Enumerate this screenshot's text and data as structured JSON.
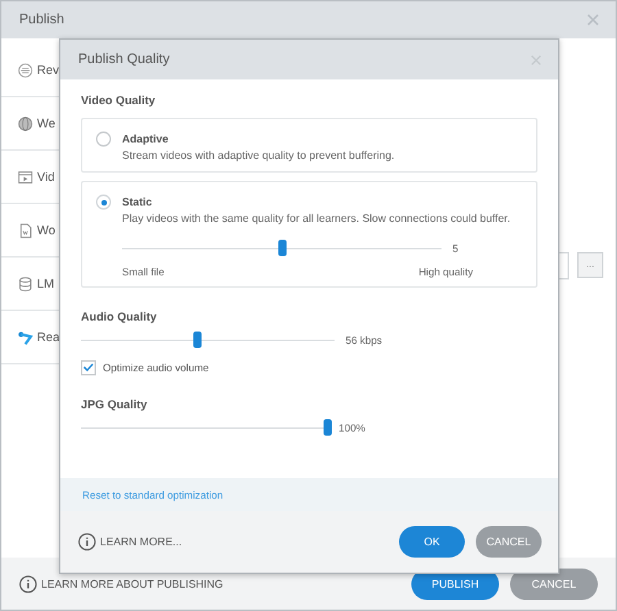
{
  "window": {
    "title": "Publish"
  },
  "sidebar": {
    "items": [
      {
        "label": "Rev"
      },
      {
        "label": "We"
      },
      {
        "label": "Vid"
      },
      {
        "label": "Wo"
      },
      {
        "label": "LM"
      },
      {
        "label": "Rea"
      }
    ]
  },
  "browse_button": "...",
  "footer": {
    "learn_more": "LEARN MORE ABOUT PUBLISHING",
    "buttons": [
      "PUBLISH",
      "CANCEL"
    ]
  },
  "dialog": {
    "title": "Publish Quality",
    "video_quality": {
      "heading": "Video Quality",
      "options": [
        {
          "label": "Adaptive",
          "description": "Stream videos with adaptive quality to prevent buffering.",
          "selected": false
        },
        {
          "label": "Static",
          "description": "Play videos with the same quality for all learners. Slow connections could buffer.",
          "selected": true,
          "slider": {
            "level": 0.5,
            "reading": "5",
            "min_label": "Small file",
            "max_label": "High quality"
          }
        }
      ]
    },
    "audio_quality": {
      "heading": "Audio Quality",
      "level": 0.46,
      "reading": "56 kbps",
      "optimize": {
        "label": "Optimize audio volume",
        "checked": true
      }
    },
    "jpg_quality": {
      "heading": "JPG Quality",
      "level": 1,
      "reading": "100%"
    },
    "reset_link": "Reset to standard optimization",
    "learn_more": "LEARN MORE...",
    "buttons": [
      "OK",
      "CANCEL"
    ]
  }
}
